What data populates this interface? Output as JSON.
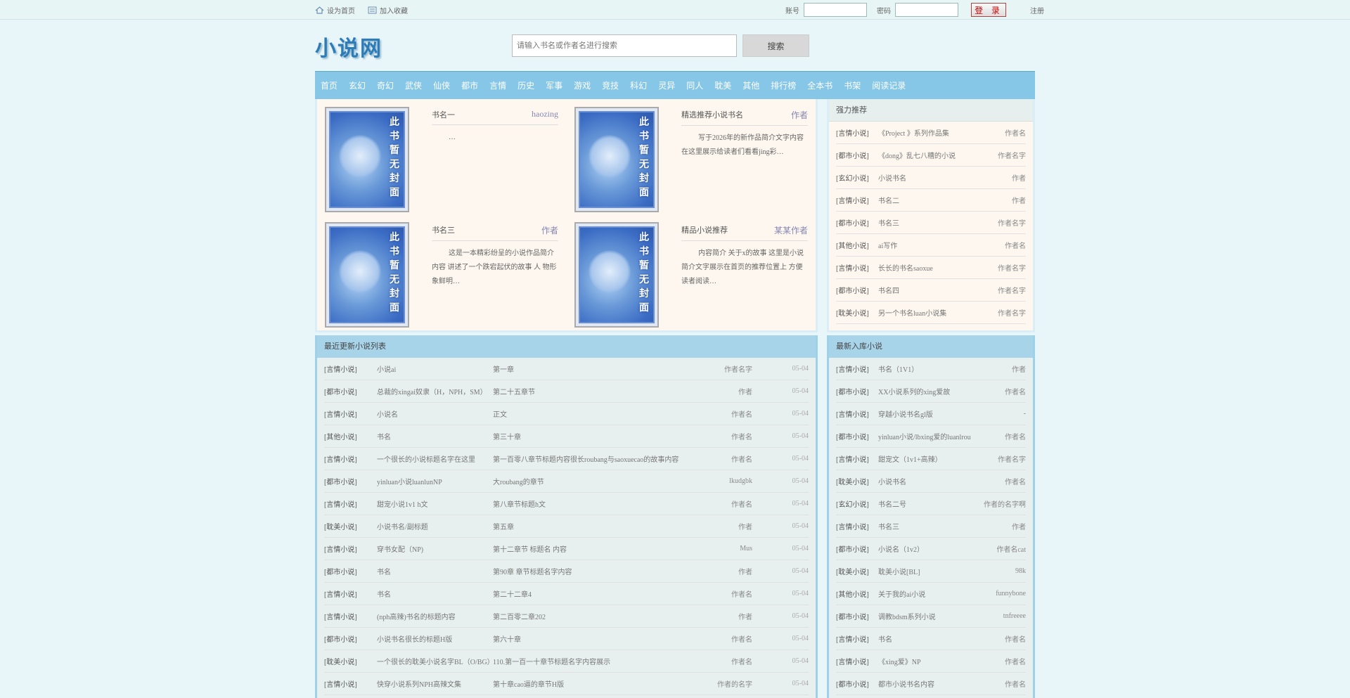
{
  "topbar": {
    "set_home": "设为首页",
    "bookmark": "加入收藏",
    "user_label": "账号",
    "pass_label": "密码",
    "login_button": "登 录",
    "register": "注册"
  },
  "header": {
    "logo": "小说网",
    "search_placeholder": "请输入书名或作者名进行搜索",
    "search_button": "搜索"
  },
  "nav": [
    "首页",
    "玄幻",
    "奇幻",
    "武侠",
    "仙侠",
    "都市",
    "言情",
    "历史",
    "军事",
    "游戏",
    "竞技",
    "科幻",
    "灵异",
    "同人",
    "耽美",
    "其他",
    "排行榜",
    "全本书",
    "书架",
    "阅读记录"
  ],
  "featured": [
    {
      "title": "书名一",
      "author": "haozing",
      "desc": "…"
    },
    {
      "title": "精选推荐小说书名",
      "author": "作者",
      "desc": "写于2026年的新作品简介文字内容在这里展示给读者们看看jing彩…"
    },
    {
      "title": "书名三",
      "author": "作者",
      "desc": "这是一本精彩纷呈的小说作品简介内容 讲述了一个跌宕起伏的故事 人 物形象鲜明…"
    },
    {
      "title": "精品小说推荐",
      "author": "某某作者",
      "desc": "内容简介 关于x的故事 这里是小说简介文字展示在首页的推荐位置上 方便读者阅读…"
    }
  ],
  "cover_text": "此书暂无封面",
  "side_top": {
    "header": "强力推荐",
    "rows": [
      {
        "cat": "[言情小说]",
        "name": "《Project 》系列作品集",
        "au": "作者名"
      },
      {
        "cat": "[都市小说]",
        "name": "《dong》乱七八糟的小说",
        "au": "作者名字"
      },
      {
        "cat": "[玄幻小说]",
        "name": "小说书名",
        "au": "作者"
      },
      {
        "cat": "[言情小说]",
        "name": "书名二",
        "au": "作者"
      },
      {
        "cat": "[都市小说]",
        "name": "书名三",
        "au": "作者名字"
      },
      {
        "cat": "[其他小说]",
        "name": "ai写作",
        "au": "作者名"
      },
      {
        "cat": "[言情小说]",
        "name": "长长的书名saoxue",
        "au": "作者名字"
      },
      {
        "cat": "[都市小说]",
        "name": "书名四",
        "au": "作者名字"
      },
      {
        "cat": "[耽美小说]",
        "name": "另一个书名luan小说集",
        "au": "作者名字"
      }
    ]
  },
  "latest": {
    "header": "最近更新小说列表",
    "rows": [
      {
        "cat": "[言情小说]",
        "name": "小说ai",
        "chap": "第一章",
        "au": "作者名字",
        "dt": "05-04"
      },
      {
        "cat": "[都市小说]",
        "name": "总裁的xingai奴隶（H，NPH，SM）",
        "chap": "第二十五章节",
        "au": "作者",
        "dt": "05-04"
      },
      {
        "cat": "[言情小说]",
        "name": "小说名",
        "chap": "正文",
        "au": "作者名",
        "dt": "05-04"
      },
      {
        "cat": "[其他小说]",
        "name": "书名",
        "chap": "第三十章",
        "au": "作者名",
        "dt": "05-04"
      },
      {
        "cat": "[言情小说]",
        "name": "一个很长的小说标题名字在这里",
        "chap": "第一百零八章节标题内容很长roubang与saoxuecao的故事内容",
        "au": "作者名",
        "dt": "05-04"
      },
      {
        "cat": "[都市小说]",
        "name": "yinluan小说luanlunNP",
        "chap": "大roubang的章节",
        "au": "lkudgbk",
        "dt": "05-04"
      },
      {
        "cat": "[言情小说]",
        "name": "甜宠小说1v1 h文",
        "chap": "第八章节标题h文",
        "au": "作者名",
        "dt": "05-04"
      },
      {
        "cat": "[耽美小说]",
        "name": "小说书名/副标题",
        "chap": "第五章",
        "au": "作者",
        "dt": "05-04"
      },
      {
        "cat": "[言情小说]",
        "name": "穿书女配（NP)",
        "chap": "第十二章节 标题名 内容",
        "au": "Mus",
        "dt": "05-04"
      },
      {
        "cat": "[都市小说]",
        "name": "书名",
        "chap": "第90章 章节标题名字内容",
        "au": "作者",
        "dt": "05-04"
      },
      {
        "cat": "[言情小说]",
        "name": "书名",
        "chap": "第二十二章4",
        "au": "作者名",
        "dt": "05-04"
      },
      {
        "cat": "[言情小说]",
        "name": "(nph高辣)书名的标题内容",
        "chap": "第二百零二章202",
        "au": "作者",
        "dt": "05-04"
      },
      {
        "cat": "[都市小说]",
        "name": "小说书名很长的标题H版",
        "chap": "第六十章",
        "au": "作者名",
        "dt": "05-04"
      },
      {
        "cat": "[耽美小说]",
        "name": "一个很长的耽美小说名字BL（O/BG）",
        "chap": "110.第一百一十章节标题名字内容展示",
        "au": "作者名",
        "dt": "05-04"
      },
      {
        "cat": "[言情小说]",
        "name": "快穿小说系列NPH高辣文集",
        "chap": "第十章cao逼的章节H版",
        "au": "作者的名字",
        "dt": "05-04"
      }
    ]
  },
  "recent": {
    "header": "最新入库小说",
    "rows": [
      {
        "cat": "[言情小说]",
        "name": "书名（1V1）",
        "au": "作者"
      },
      {
        "cat": "[都市小说]",
        "name": "XX小说系列的xing爱故",
        "au": "作者名"
      },
      {
        "cat": "[言情小说]",
        "name": "穿越小说书名gl版",
        "au": "-"
      },
      {
        "cat": "[都市小说]",
        "name": "yinluan小说/lbxing爱的luanlrou",
        "au": "作者名"
      },
      {
        "cat": "[言情小说]",
        "name": "甜宠文（1v1+高辣）",
        "au": "作者名字"
      },
      {
        "cat": "[耽美小说]",
        "name": "小说书名",
        "au": "作者名"
      },
      {
        "cat": "[玄幻小说]",
        "name": "书名二号",
        "au": "作者的名字啊"
      },
      {
        "cat": "[言情小说]",
        "name": "书名三",
        "au": "作者"
      },
      {
        "cat": "[都市小说]",
        "name": "小说名（1v2）",
        "au": "作者名cat"
      },
      {
        "cat": "[耽美小说]",
        "name": "耽美小说[BL]",
        "au": "98k"
      },
      {
        "cat": "[其他小说]",
        "name": "关于我的ai小说",
        "au": "funnybone"
      },
      {
        "cat": "[都市小说]",
        "name": "调教bdsm系列小说",
        "au": "tnfreeee"
      },
      {
        "cat": "[言情小说]",
        "name": "书名",
        "au": "作者名"
      },
      {
        "cat": "[言情小说]",
        "name": "《xing爱》NP",
        "au": "作者名"
      },
      {
        "cat": "[都市小说]",
        "name": "都市小说书名内容",
        "au": "作者名"
      }
    ]
  }
}
